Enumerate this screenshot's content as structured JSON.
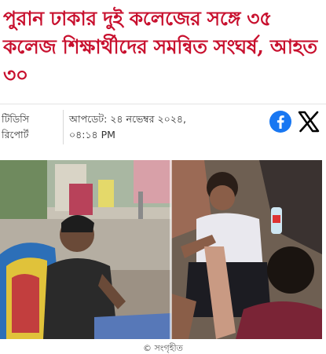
{
  "headline": "পুরান ঢাকার দুই কলেজের সঙ্গে ৩৫ কলেজ শিক্ষার্থীদের সমন্বিত সংঘর্ষ, আহত ৩০",
  "byline": {
    "line1": "টিডিসি",
    "line2": "রিপোর্ট"
  },
  "dateline": {
    "line1": "আপডেট: ২৪ নভেম্বর ২০২৪,",
    "line2": "০৪:১৪ PM"
  },
  "share": {
    "facebook_icon": "facebook-icon",
    "x_icon": "x-twitter-icon",
    "facebook_color": "#1877f2",
    "x_color": "#000000"
  },
  "photo": {
    "caption": "© সংগৃহীত"
  },
  "colors": {
    "headline": "#c8102e"
  }
}
